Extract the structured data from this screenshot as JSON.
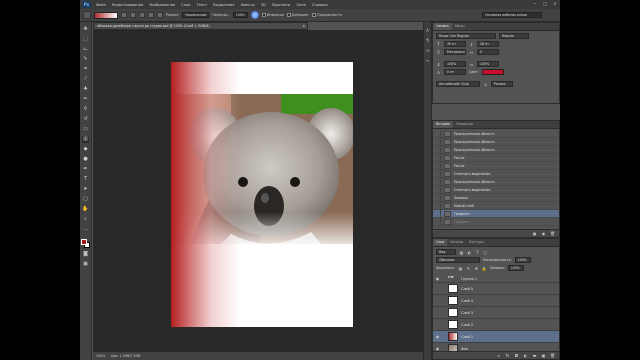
{
  "menu": {
    "logo": "Ps",
    "items": [
      "Файл",
      "Редактирование",
      "Изображение",
      "Слои",
      "Текст",
      "Выделение",
      "Фильтр",
      "3D",
      "Просмотр",
      "Окно",
      "Справка"
    ],
    "window_buttons": [
      "−",
      "□",
      "×"
    ]
  },
  "options": {
    "mode_label": "Режим:",
    "mode_value": "Нормальный",
    "opacity_label": "Непрозр.:",
    "opacity_value": "100%",
    "inverse_label": "Инверсия",
    "dither_label": "Дизеринг",
    "transparency_label": "Прозрачность",
    "workspace": "Основная рабочая среда"
  },
  "document": {
    "tab_title": "обложка дизайнера с вуссо до студии.psd @ 100% (Слой 1, RGB/8)",
    "close": "×"
  },
  "statusbar": {
    "zoom": "100%",
    "doc_info": "Док: 1,49M/7,50M"
  },
  "character": {
    "tabs": [
      "Символ",
      "Абзац"
    ],
    "font": "Russo One Regular",
    "style": "Regular",
    "size": "30 пт",
    "leading": "28 пт",
    "kerning": "Метрические",
    "tracking": "0",
    "vscale": "100%",
    "hscale": "100%",
    "baseline": "0 пт",
    "color_label": "Цвет:",
    "color": "#c8102e",
    "language": "Английский: США",
    "aa": "Резкое"
  },
  "history": {
    "tabs": [
      "История",
      "Операции"
    ],
    "items": [
      {
        "label": "Прямоугольная область",
        "state": "normal"
      },
      {
        "label": "Прямоугольная область",
        "state": "normal"
      },
      {
        "label": "Прямоугольная область",
        "state": "normal"
      },
      {
        "label": "Растяг",
        "state": "normal"
      },
      {
        "label": "Растяг",
        "state": "normal"
      },
      {
        "label": "Отменить выделение",
        "state": "normal"
      },
      {
        "label": "Прямоугольная область",
        "state": "normal"
      },
      {
        "label": "Отменить выделение",
        "state": "normal"
      },
      {
        "label": "Заливка",
        "state": "normal"
      },
      {
        "label": "Новый слой",
        "state": "normal"
      },
      {
        "label": "Градиент",
        "state": "active"
      },
      {
        "label": "Градиент",
        "state": "dim"
      }
    ]
  },
  "layers": {
    "tabs": [
      "Слои",
      "Каналы",
      "Контуры"
    ],
    "filter_label": "Вид",
    "blend_mode": "Обычные",
    "opacity_label": "Непрозрачность:",
    "opacity": "100%",
    "lock_label": "Закрепить:",
    "fill_label": "Заливка:",
    "fill": "100%",
    "items": [
      {
        "name": "Группа 1",
        "kind": "folder",
        "active": false
      },
      {
        "name": "Слой 5",
        "kind": "plain",
        "active": false
      },
      {
        "name": "Слой 4",
        "kind": "plain",
        "active": false
      },
      {
        "name": "Слой 3",
        "kind": "plain",
        "active": false
      },
      {
        "name": "Слой 2",
        "kind": "plain",
        "active": false
      },
      {
        "name": "Слой 1",
        "kind": "grad",
        "active": true
      },
      {
        "name": "Фон",
        "kind": "photo",
        "active": false
      }
    ]
  }
}
